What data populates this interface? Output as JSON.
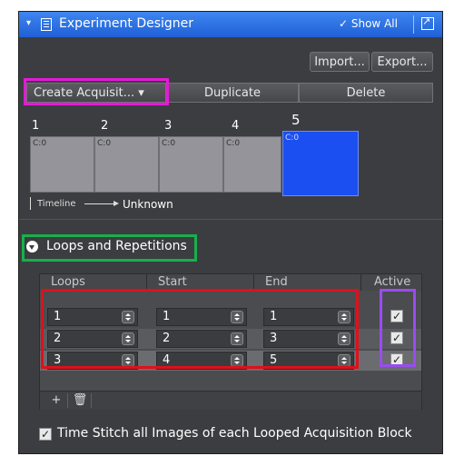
{
  "titlebar": {
    "title": "Experiment Designer",
    "show_all": "✓ Show All",
    "accent": "#2a6ee5"
  },
  "toolbar": {
    "import_label": "Import...",
    "export_label": "Export...",
    "create_label": "Create Acquisit... ▾",
    "duplicate_label": "Duplicate",
    "delete_label": "Delete"
  },
  "blocks": [
    {
      "number": "1",
      "label": "C:0",
      "selected": false
    },
    {
      "number": "2",
      "label": "C:0",
      "selected": false
    },
    {
      "number": "3",
      "label": "C:0",
      "selected": false
    },
    {
      "number": "4",
      "label": "C:0",
      "selected": false
    },
    {
      "number": "5",
      "label": "C:0",
      "selected": true
    }
  ],
  "timeline": {
    "label": "Timeline",
    "value": "Unknown"
  },
  "loops_section": {
    "title": "Loops and Repetitions",
    "columns": [
      "Loops",
      "Start",
      "End",
      "Active"
    ],
    "rows": [
      {
        "loops": "1",
        "start": "1",
        "end": "1",
        "active": true
      },
      {
        "loops": "2",
        "start": "2",
        "end": "3",
        "active": true
      },
      {
        "loops": "3",
        "start": "4",
        "end": "5",
        "active": true
      }
    ],
    "footer": {
      "add": "+",
      "delete_icon": "trash-icon"
    }
  },
  "stitch": {
    "label": "Time Stitch all Images of each Looped Acquisition Block",
    "checked": true
  },
  "highlights": {
    "magenta": "#e619d8",
    "green": "#17b04a",
    "red": "#e0101a",
    "purple": "#9a4cf0"
  }
}
